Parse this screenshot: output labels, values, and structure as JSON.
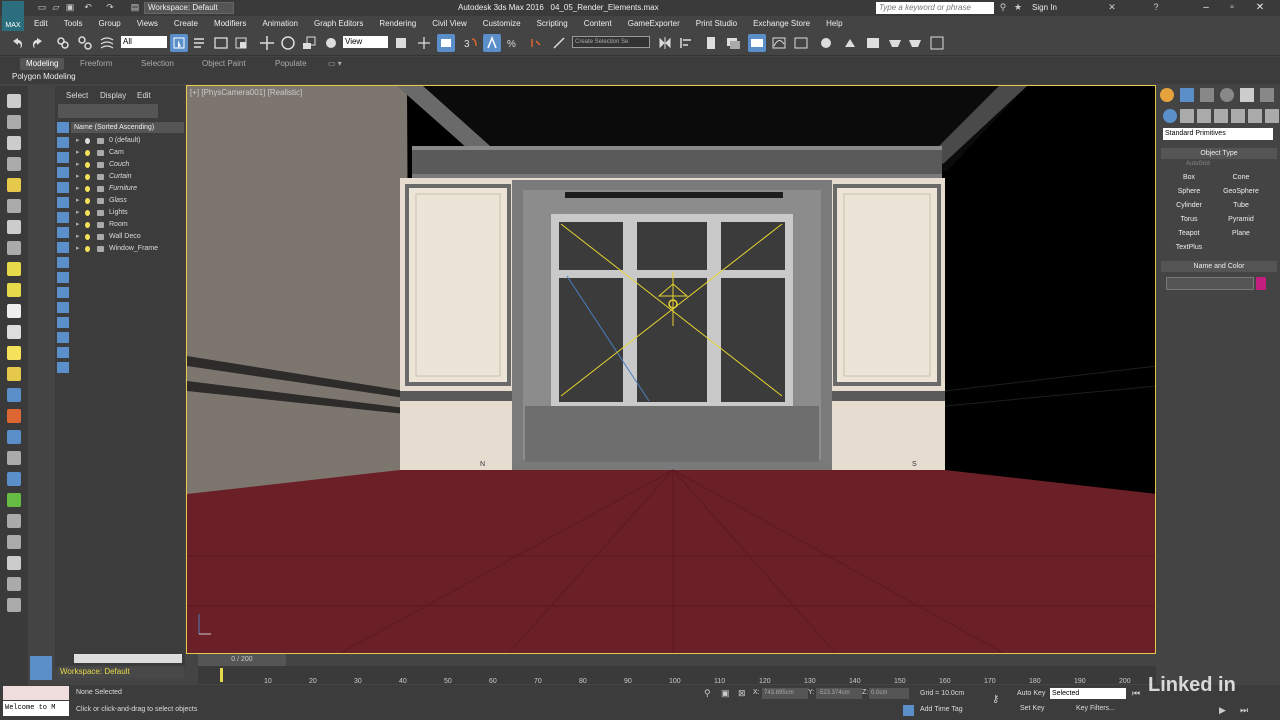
{
  "title_bar": {
    "workspace": "Workspace: Default",
    "app_title": "Autodesk 3ds Max 2016",
    "file_name": "04_05_Render_Elements.max",
    "search_placeholder": "Type a keyword or phrase",
    "sign_in": "Sign In",
    "logo_text": "MAX"
  },
  "menu": [
    "Edit",
    "Tools",
    "Group",
    "Views",
    "Create",
    "Modifiers",
    "Animation",
    "Graph Editors",
    "Rendering",
    "Civil View",
    "Customize",
    "Scripting",
    "Content",
    "GameExporter",
    "Print Studio",
    "Exchange Store",
    "Help"
  ],
  "toolbar": {
    "selection_filter": "All",
    "reference_coord": "View",
    "named_selection": "Create Selection Se"
  },
  "ribbon": {
    "tabs": [
      "Modeling",
      "Freeform",
      "Selection",
      "Object Paint",
      "Populate"
    ],
    "active_tab": "Modeling",
    "panel_label": "Polygon Modeling"
  },
  "explorer": {
    "tabs": [
      "Select",
      "Display",
      "Edit"
    ],
    "header": "Name (Sorted Ascending)",
    "rows": [
      {
        "name": "0 (default)",
        "italic": false,
        "bulb_on": false
      },
      {
        "name": "Cam",
        "italic": false,
        "bulb_on": true
      },
      {
        "name": "Couch",
        "italic": true,
        "bulb_on": true
      },
      {
        "name": "Curtain",
        "italic": true,
        "bulb_on": true
      },
      {
        "name": "Furniture",
        "italic": true,
        "bulb_on": true
      },
      {
        "name": "Glass",
        "italic": true,
        "bulb_on": true
      },
      {
        "name": "Lights",
        "italic": false,
        "bulb_on": true
      },
      {
        "name": "Room",
        "italic": false,
        "bulb_on": true
      },
      {
        "name": "Wall Deco",
        "italic": false,
        "bulb_on": true
      },
      {
        "name": "Window_Frame",
        "italic": false,
        "bulb_on": true
      }
    ]
  },
  "viewport": {
    "label": "[+] [PhysCamera001] [Realistic]",
    "compass_n": "N",
    "compass_s": "S"
  },
  "command_panel": {
    "category": "Standard Primitives",
    "object_type_title": "Object Type",
    "autogrid": "AutoGrid",
    "buttons": [
      "Box",
      "Cone",
      "Sphere",
      "GeoSphere",
      "Cylinder",
      "Tube",
      "Torus",
      "Pyramid",
      "Teapot",
      "Plane",
      "TextPlus"
    ],
    "name_color_title": "Name and Color",
    "object_color": "#c21e7f"
  },
  "bottom": {
    "workspace": "Workspace: Default",
    "time_slider": "0 / 200",
    "ticks": [
      "10",
      "20",
      "30",
      "40",
      "50",
      "60",
      "70",
      "80",
      "90",
      "100",
      "110",
      "120",
      "130",
      "140",
      "150",
      "160",
      "170",
      "180",
      "190",
      "200"
    ],
    "maxscript_listener": "",
    "maxscript_text": "Welcome to M",
    "status_selection": "None Selected",
    "status_prompt": "Click or click-and-drag to select objects",
    "x_label": "X:",
    "x_value": "743.895cm",
    "y_label": "Y:",
    "y_value": "-523.374cm",
    "z_label": "Z:",
    "z_value": "0.0cm",
    "grid": "Grid = 10.0cm",
    "add_time_tag": "Add Time Tag",
    "auto_key": "Auto Key",
    "set_key": "Set Key",
    "key_mode": "Selected",
    "key_filters": "Key Filters...",
    "watermark": "Linked in"
  }
}
